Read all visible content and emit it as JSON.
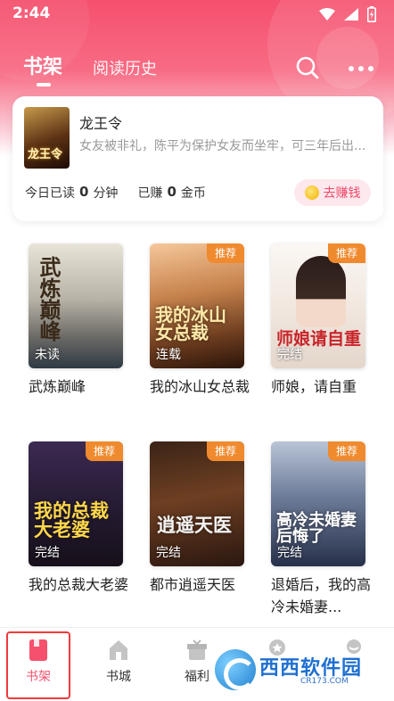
{
  "status_bar": {
    "time": "2:44"
  },
  "header": {
    "tabs": [
      {
        "label": "书架",
        "active": true
      },
      {
        "label": "阅读历史",
        "active": false
      }
    ]
  },
  "reading_card": {
    "title": "龙王令",
    "description": "女友被非礼，陈平为保护女友而坐牢，可三年后出...",
    "cover_text": "龙王令",
    "today_read_label": "今日已读",
    "today_read_value": "0",
    "today_read_unit": "分钟",
    "earned_label": "已赚",
    "earned_value": "0",
    "earned_unit": "金币",
    "earn_button": "去赚钱"
  },
  "books": [
    {
      "title": "武炼巅峰",
      "status": "未读",
      "tag": "",
      "cover_text": "武炼巅峰"
    },
    {
      "title": "我的冰山女总裁",
      "status": "连载",
      "tag": "推荐",
      "cover_text": "我的冰山女总裁"
    },
    {
      "title": "师娘，请自重",
      "status": "完结",
      "tag": "推荐",
      "cover_text": "师娘请自重"
    },
    {
      "title": "我的总裁大老婆",
      "status": "完结",
      "tag": "推荐",
      "cover_text": "我的总裁大老婆"
    },
    {
      "title": "都市逍遥天医",
      "status": "完结",
      "tag": "推荐",
      "cover_text": "逍遥天医"
    },
    {
      "title": "退婚后，我的高冷未婚妻...",
      "status": "完结",
      "tag": "推荐",
      "cover_text": "高冷未婚妻后悔了"
    }
  ],
  "bottom_nav": [
    {
      "label": "书架",
      "icon": "bookshelf-icon",
      "active": true
    },
    {
      "label": "书城",
      "icon": "store-icon",
      "active": false
    },
    {
      "label": "福利",
      "icon": "gift-icon",
      "active": false
    },
    {
      "label": "",
      "icon": "medal-icon",
      "active": false
    },
    {
      "label": "",
      "icon": "profile-icon",
      "active": false
    }
  ],
  "watermark": {
    "text": "西西软件园",
    "sub": "CR173.COM"
  },
  "colors": {
    "accent": "#f5506d",
    "tag": "#f08a2e",
    "earn_text": "#f2486a"
  }
}
